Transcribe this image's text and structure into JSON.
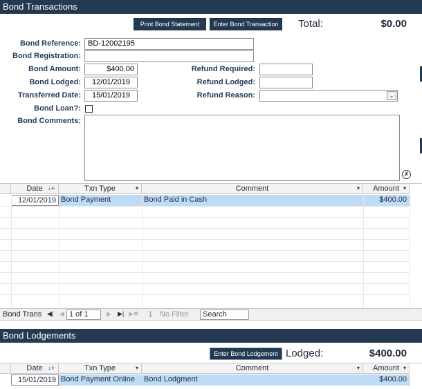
{
  "transactions": {
    "header": "Bond Transactions",
    "print_button": "Print Bond Statement",
    "enter_button": "Enter Bond Transaction",
    "total_label": "Total:",
    "total_value": "$0.00"
  },
  "form": {
    "reference_label": "Bond Reference:",
    "reference_value": "BD-12002195",
    "registration_label": "Bond Registration:",
    "registration_value": "",
    "amount_label": "Bond Amount:",
    "amount_value": "$400.00",
    "lodged_label": "Bond Lodged:",
    "lodged_value": "12/01/2019",
    "transferred_label": "Transferred Date:",
    "transferred_value": "15/01/2019",
    "loan_label": "Bond Loan?:",
    "loan_checked": false,
    "comments_label": "Bond Comments:",
    "comments_value": "",
    "refund_required_label": "Refund Required:",
    "refund_required_value": "",
    "refund_lodged_label": "Refund Lodged:",
    "refund_lodged_value": "",
    "refund_reason_label": "Refund Reason:",
    "refund_reason_value": ""
  },
  "trans_grid": {
    "columns": [
      "Date",
      "Txn Type",
      "Comment",
      "Amount"
    ],
    "rows": [
      {
        "date": "12/01/2019",
        "type": "Bond Payment",
        "comment": "Bond Paid in Cash",
        "amount": "$400.00"
      }
    ]
  },
  "navigator": {
    "label": "Bond Trans",
    "record": "1 of 1",
    "filter": "No Filter",
    "search_placeholder": "Search"
  },
  "lodgements": {
    "header": "Bond Lodgements",
    "enter_button": "Enter Bond Lodgement",
    "lodged_label": "Lodged:",
    "lodged_value": "$400.00",
    "columns": [
      "Date",
      "Txn Type",
      "Comment",
      "Amount"
    ],
    "rows": [
      {
        "date": "15/01/2019",
        "type": "Bond Payment Online",
        "comment": "Bond Lodgment",
        "amount": "$400.00"
      }
    ]
  },
  "colors": {
    "header_bg": "#243a52",
    "selected_row": "#bfdcf7"
  }
}
